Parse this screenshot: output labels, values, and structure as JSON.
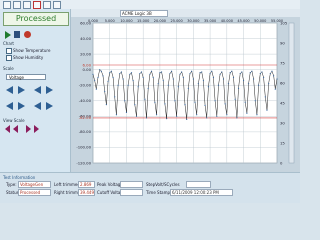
{
  "app": {
    "title": "Processed"
  },
  "toolbar": {
    "icons": [
      "folder-icon",
      "save-icon",
      "print-icon",
      "close-icon",
      "grid-icon",
      "page-icon"
    ]
  },
  "chart_panel": {
    "section_chart": "Chart",
    "show_temperature": "Show Temperature",
    "show_humidity": "Show Humidity",
    "section_scale": "Scale",
    "scale_select": "Voltage",
    "section_view": "View Scale"
  },
  "header": {
    "range_label": "ACME Logic 3B"
  },
  "test_info": {
    "title": "Test Information",
    "type_label": "Type:",
    "type_value": "VoltageGen",
    "status_label": "Status:",
    "status_value": "Processed",
    "left_trimmed_label": "Left trimmed at",
    "left_trimmed_value": "2.869",
    "right_trimmed_label": "Right trimmed at",
    "right_trimmed_value": "39.449",
    "peak_voltage_label": "Peak Voltage",
    "cutoff_voltage_label": "Cutoff Voltage",
    "stepvolt_label": "StepVolt/SCycles",
    "time_stamp_label": "Time Stamp",
    "time_stamp_value": "6/11/2009 12:00:23 PM"
  },
  "chart_data": {
    "type": "line",
    "title": "",
    "xlabel": "",
    "ylabel": "",
    "x_ticks": [
      "0.000",
      "5.000",
      "10.000",
      "15.000",
      "20.000",
      "25.000",
      "30.000",
      "35.000",
      "40.000",
      "45.000",
      "50.000",
      "55.000"
    ],
    "y_ticks": [
      "60.00",
      "40.00",
      "20.00",
      "0.00",
      "-20.00",
      "-40.00",
      "-60.00",
      "-80.00",
      "-100.00",
      "-120.00"
    ],
    "y_right_ticks": [
      "105",
      "90",
      "75",
      "60",
      "45",
      "30",
      "15",
      "0"
    ],
    "xlim": [
      0,
      55
    ],
    "ylim": [
      -120,
      60
    ],
    "grid": true,
    "ref_lines": [
      6.0,
      -62.0
    ],
    "ref_labels": [
      "6.00",
      "-62.00"
    ],
    "series": [
      {
        "color": "#222222",
        "x": [
          0,
          0.5,
          1,
          1.5,
          2,
          2.5,
          3,
          3.5,
          4,
          4.5,
          5,
          5.5,
          6,
          6.5,
          7,
          7.5,
          8,
          8.5,
          9,
          9.5,
          10,
          10.5,
          11,
          11.5,
          12,
          12.5,
          13,
          13.5,
          14,
          14.5,
          15,
          15.5,
          16,
          16.5,
          17,
          17.5,
          18,
          18.5,
          19,
          19.5,
          20,
          20.5,
          21,
          21.5,
          22,
          22.5,
          23,
          23.5,
          24,
          24.5,
          25,
          25.5,
          26,
          26.5,
          27,
          27.5,
          28,
          28.5,
          29,
          29.5,
          30,
          30.5,
          31,
          31.5,
          32,
          32.5,
          33,
          33.5,
          34,
          34.5,
          35,
          35.5,
          36,
          36.5,
          37,
          37.5,
          38,
          38.5,
          39,
          39.5,
          40,
          40.5,
          41,
          41.5,
          42,
          42.5,
          43,
          43.5,
          44,
          44.5,
          45,
          45.5,
          46,
          46.5,
          47,
          47.5,
          48,
          48.5,
          49,
          49.5,
          50,
          50.5,
          51,
          51.5,
          52,
          52.5,
          53,
          53.5,
          54,
          54.5,
          55
        ],
        "values": [
          -6,
          -14,
          -25,
          -10,
          0,
          -2,
          -8,
          -28,
          -45,
          -15,
          -4,
          -2,
          -10,
          -35,
          -58,
          -20,
          -5,
          -3,
          -12,
          -40,
          -55,
          -20,
          -6,
          -4,
          -14,
          -45,
          -60,
          -22,
          -5,
          -3,
          -10,
          -38,
          -62,
          -24,
          -6,
          -2,
          -10,
          -42,
          -58,
          -18,
          -4,
          -3,
          -14,
          -44,
          -63,
          -20,
          -5,
          -2,
          -12,
          -40,
          -60,
          -22,
          -6,
          -3,
          -10,
          -45,
          -64,
          -24,
          -5,
          -2,
          -12,
          -42,
          -58,
          -18,
          -4,
          -3,
          -14,
          -46,
          -62,
          -22,
          -5,
          -2,
          -10,
          -40,
          -60,
          -20,
          -6,
          -3,
          -12,
          -44,
          -58,
          -18,
          -4,
          -2,
          -10,
          -38,
          -62,
          -24,
          -5,
          -3,
          -14,
          -42,
          -56,
          -18,
          -4,
          -2,
          -12,
          -40,
          -58,
          -20,
          -5,
          -3,
          -10,
          -35,
          -52,
          -18,
          -5,
          -2,
          -8,
          -25,
          -12
        ]
      }
    ]
  }
}
